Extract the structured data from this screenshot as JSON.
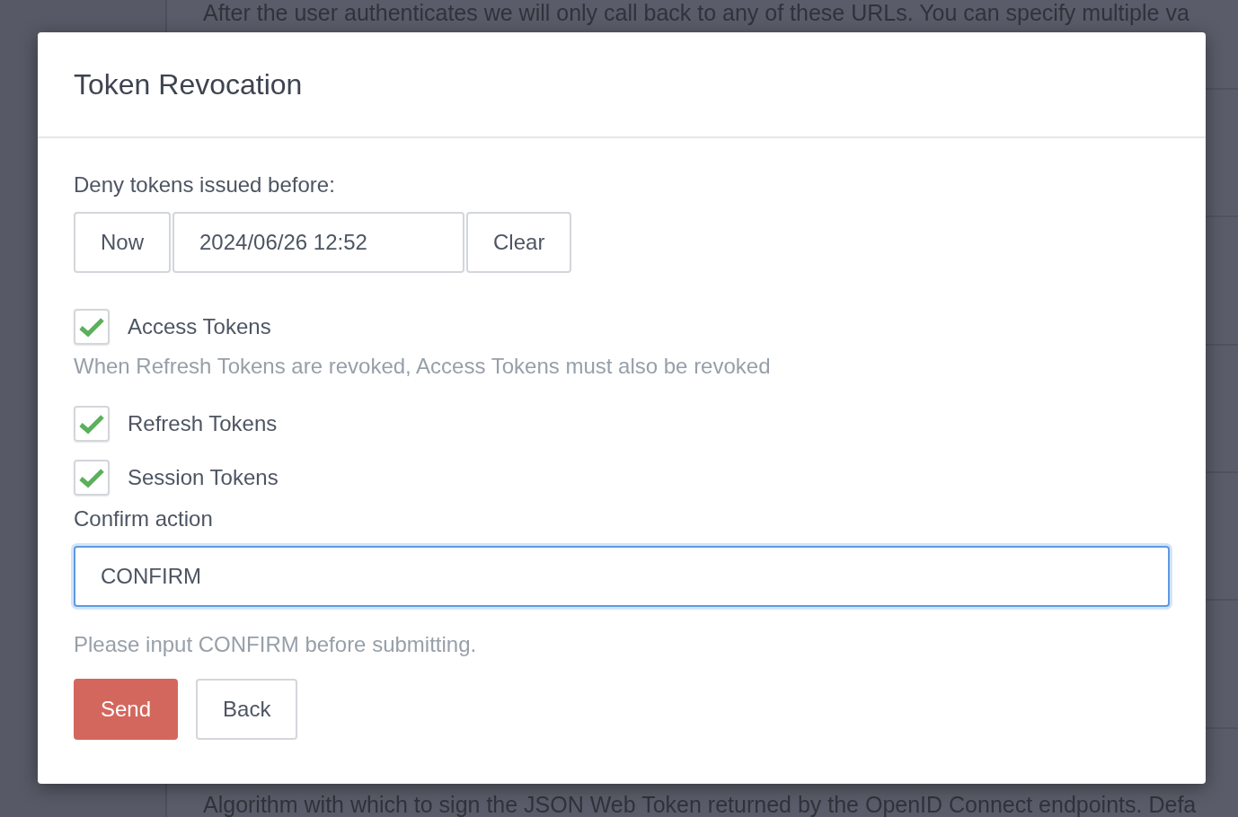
{
  "background": {
    "texts": [
      "After the user authenticates we will only call back to any of these URLs. You can specify multiple va",
      "Algorithm with which to sign the JSON Web Token returned by the OpenID Connect endpoints. Defa"
    ]
  },
  "dialog": {
    "title": "Token Revocation",
    "deny_label": "Deny tokens issued before:",
    "now_button": "Now",
    "date_value": "2024/06/26 12:52",
    "clear_button": "Clear",
    "items": [
      {
        "kind": "checkbox",
        "label": "Access Tokens",
        "checked": true
      },
      {
        "kind": "note",
        "label": "When Refresh Tokens are revoked, Access Tokens must also be revoked"
      },
      {
        "kind": "checkbox",
        "label": "Refresh Tokens",
        "checked": true
      },
      {
        "kind": "checkbox",
        "label": "Session Tokens",
        "checked": true
      }
    ],
    "confirm_label": "Confirm action",
    "confirm_field": {
      "value": "CONFIRM",
      "focused": true
    },
    "confirm_help": "Please input CONFIRM before submitting.",
    "buttons": [
      {
        "label": "Send",
        "kind": "primary"
      },
      {
        "label": "Back",
        "kind": "default"
      }
    ]
  }
}
